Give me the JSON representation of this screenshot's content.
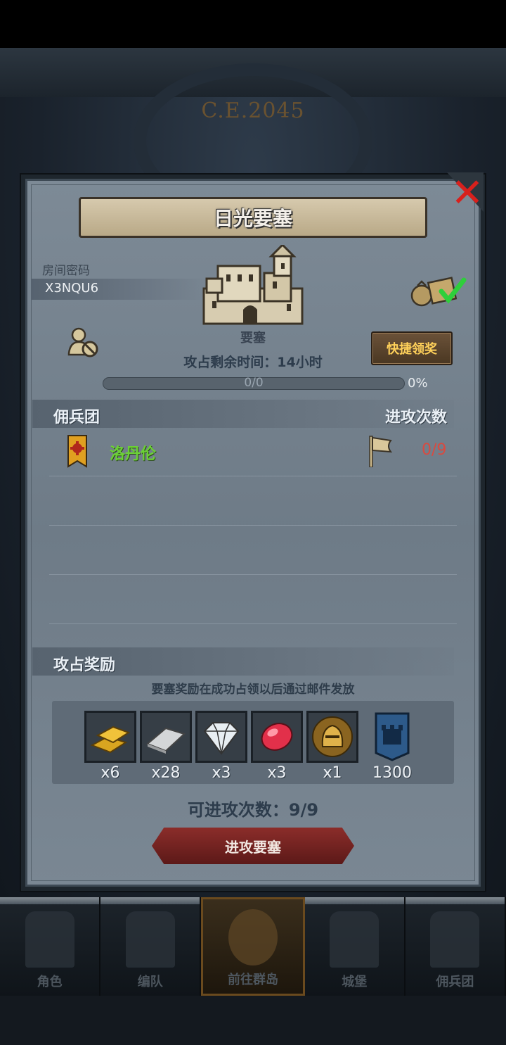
{
  "background": {
    "era_text": "C.E.2045"
  },
  "dialog": {
    "title": "日光要塞",
    "room_code_label": "房间密码",
    "room_code": "X3NQU6",
    "fortress_label": "要塞",
    "quick_claim_label": "快捷领奖",
    "occupy_time": "攻占剩余时间：14小时",
    "progress_text": "0/0",
    "progress_percent_text": "0%",
    "progress_value": 0,
    "mercenary_section": "佣兵团",
    "attack_count_section": "进攻次数",
    "mercenary_rows": [
      {
        "name": "洛丹伦",
        "attack_count": "0/9"
      }
    ],
    "reward_section": "攻占奖励",
    "reward_note": "要塞奖励在成功占领以后通过邮件发放",
    "rewards": [
      {
        "icon": "gold-bar-icon",
        "count": "x6"
      },
      {
        "icon": "silver-bar-icon",
        "count": "x28"
      },
      {
        "icon": "diamond-icon",
        "count": "x3"
      },
      {
        "icon": "ruby-icon",
        "count": "x3"
      },
      {
        "icon": "knight-helmet-coin-icon",
        "count": "x1"
      },
      {
        "icon": "fortress-badge-icon",
        "count": "1300"
      }
    ],
    "attacks_left": "可进攻次数：9/9",
    "attack_button": "进攻要塞"
  },
  "bottom_nav": [
    {
      "label": "角色",
      "icon": "knight-icon"
    },
    {
      "label": "编队",
      "icon": "helmet-icon"
    },
    {
      "label": "前往群岛",
      "icon": "compass-icon"
    },
    {
      "label": "城堡",
      "icon": "castle-icon"
    },
    {
      "label": "佣兵团",
      "icon": "banner-icon"
    }
  ],
  "colors": {
    "accent_gold": "#ffd15a",
    "team_name_green": "#6bd036",
    "attack_count_red": "#d94a40",
    "close_red": "#d8201c"
  }
}
